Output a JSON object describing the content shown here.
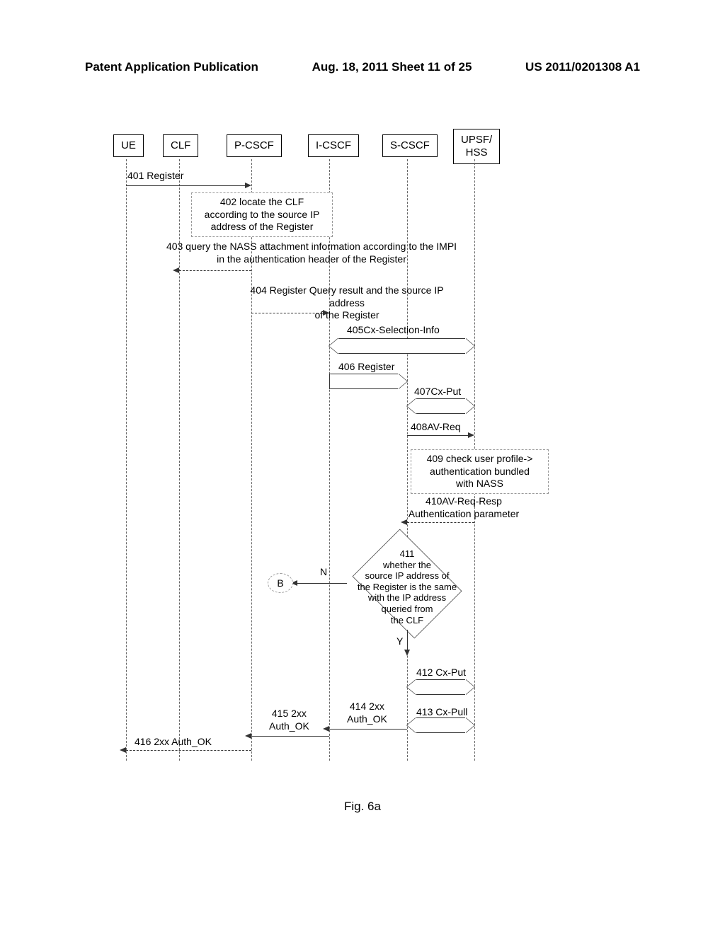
{
  "header": {
    "left": "Patent Application Publication",
    "center": "Aug. 18, 2011  Sheet 11 of 25",
    "right": "US 2011/0201308 A1"
  },
  "actors": {
    "ue": "UE",
    "clf": "CLF",
    "pcscf": "P-CSCF",
    "icscf": "I-CSCF",
    "scscf": "S-CSCF",
    "upsf": "UPSF/\nHSS"
  },
  "steps": {
    "s401": "401 Register",
    "s402": "402 locate the CLF\naccording to the source IP\naddress of the Register",
    "s403": "403 query the NASS attachment information according to the IMPI\nin the authentication header of the Register",
    "s404": "404 Register Query result and the source IP address\nof the Register",
    "s405": "405Cx-Selection-Info",
    "s406": "406 Register",
    "s407": "407Cx-Put",
    "s408": "408AV-Req",
    "s409": "409 check user profile->\nauthentication bundled\nwith NASS",
    "s410": "410AV-Req-Resp\nAuthentication parameter",
    "s411": "411\nwhether the\nsource IP address of\nthe Register is the same\nwith the IP address\nqueried from\nthe CLF",
    "s412": "412 Cx-Put",
    "s413": "413 Cx-Pull",
    "s414": "414 2xx\nAuth_OK",
    "s415": "415 2xx\nAuth_OK",
    "s416": "416 2xx Auth_OK"
  },
  "markers": {
    "n": "N",
    "y": "Y",
    "b": "B"
  },
  "caption": "Fig. 6a"
}
